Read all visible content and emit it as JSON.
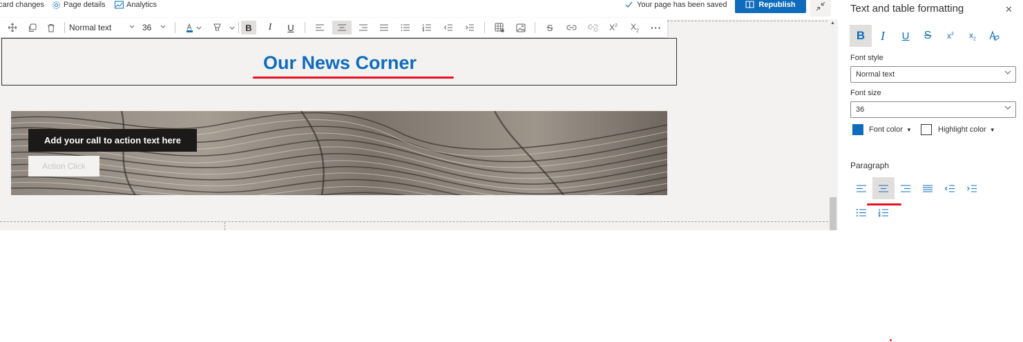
{
  "topbar": {
    "discard_label": "card changes",
    "page_details_label": "Page details",
    "analytics_label": "Analytics",
    "saved_status": "Your page has been saved",
    "republish_label": "Republish"
  },
  "toolbar": {
    "font_style": "Normal text",
    "font_size": "36",
    "font_color": "#0f6cbd"
  },
  "title": {
    "text": "Our News Corner",
    "color": "#0f6cbd"
  },
  "hero": {
    "cta_text": "Add your call to action text here",
    "cta_button": "Action Click"
  },
  "panel": {
    "title": "Text and table formatting",
    "font_style_label": "Font style",
    "font_style_value": "Normal text",
    "font_size_label": "Font size",
    "font_size_value": "36",
    "font_color_label": "Font color",
    "font_color": "#0f6cbd",
    "highlight_color_label": "Highlight color",
    "paragraph_label": "Paragraph"
  },
  "colors": {
    "accent": "#0f6cbd",
    "annotation_red": "#e81123",
    "canvas_bg": "#f3f2f1"
  }
}
